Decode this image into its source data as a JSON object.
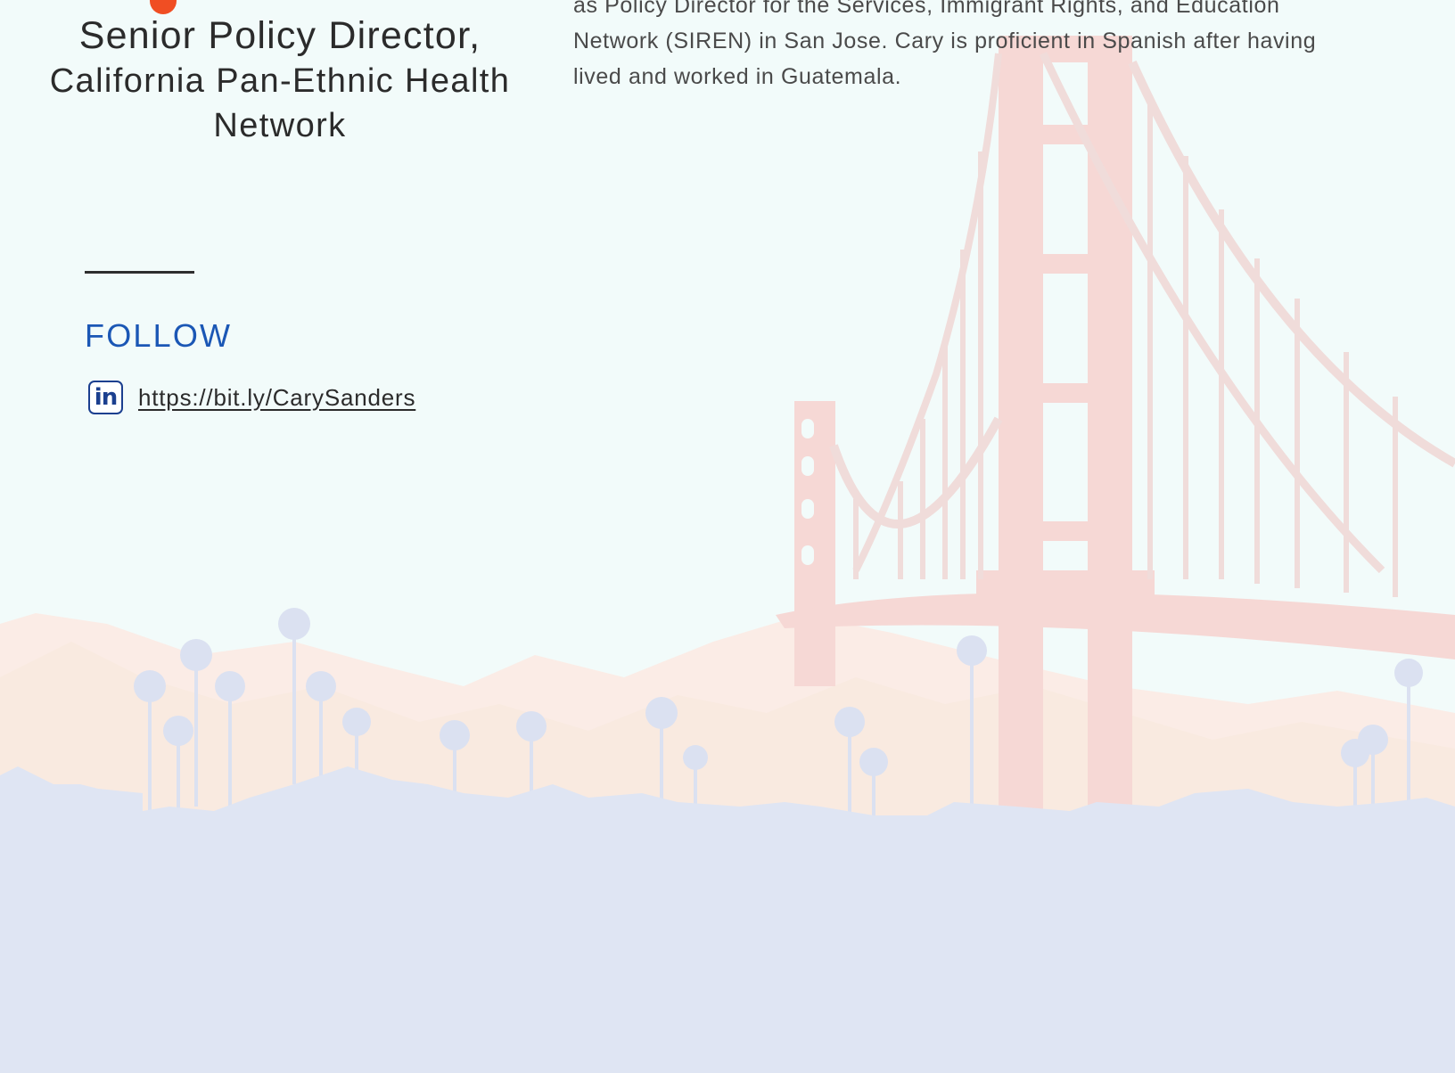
{
  "profile": {
    "role": "Senior Policy Director,",
    "organization": "California Pan-Ethnic Health Network"
  },
  "bio": {
    "lines": [
      "as Policy Director for the Services, Immigrant Rights, and Education",
      "Network (SIREN) in San Jose. Cary is proficient in Spanish after having",
      "lived and worked in Guatemala."
    ]
  },
  "follow": {
    "heading": "FOLLOW",
    "linkedin_icon_text": "in",
    "linkedin_url": "https://bit.ly/CarySanders"
  },
  "colors": {
    "accent_orange": "#f04e23",
    "follow_blue": "#1b57b5",
    "linkedin_blue": "#1b3f8f",
    "background": "#f2fbfa",
    "skyline": "#dfe5f3",
    "bridge": "#f7d9d6"
  }
}
